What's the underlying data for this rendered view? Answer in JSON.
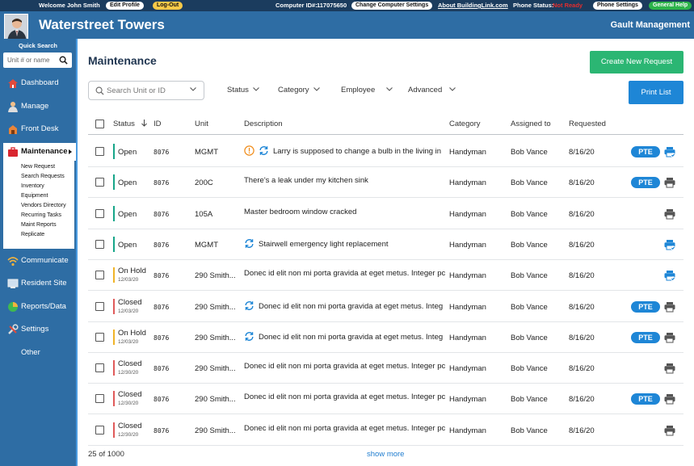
{
  "topbar": {
    "welcome": "Welcome John Smith",
    "edit_profile": "Edit Profile",
    "logout": "Log-Out",
    "computer_id_label": "Computer ID#:",
    "computer_id": "117075650",
    "change_computer_settings": "Change Computer Settings",
    "about": "About BuildingLink.com",
    "phone_status_label": "Phone Status:",
    "phone_status": "Not Ready",
    "phone_settings": "Phone Settings",
    "general_help": "General Help"
  },
  "header": {
    "building_name": "Waterstreet Towers",
    "company_name": "Gault Management"
  },
  "sidebar": {
    "quick_search_label": "Quick Search",
    "quick_search_placeholder": "Unit # or name",
    "items": [
      {
        "label": "Dashboard",
        "icon": "dashboard-icon"
      },
      {
        "label": "Manage",
        "icon": "manage-icon"
      },
      {
        "label": "Front Desk",
        "icon": "front-desk-icon"
      },
      {
        "label": "Maintenance",
        "icon": "maintenance-icon"
      },
      {
        "label": "Communicate",
        "icon": "communicate-icon"
      },
      {
        "label": "Resident Site",
        "icon": "resident-site-icon"
      },
      {
        "label": "Reports/Data",
        "icon": "reports-icon"
      },
      {
        "label": "Settings",
        "icon": "settings-icon"
      },
      {
        "label": "Other",
        "icon": ""
      }
    ],
    "submenu": [
      "New Request",
      "Search Requests",
      "Inventory",
      "Equipment",
      "Vendors Directory",
      "Recurring Tasks",
      "Maint Reports",
      "Replicate"
    ]
  },
  "main": {
    "title": "Maintenance",
    "create_button": "Create New Request",
    "print_button": "Print List",
    "search_placeholder": "Search Unit or ID",
    "filters": [
      "Status",
      "Category",
      "Employee",
      "Advanced"
    ],
    "columns": [
      "Status",
      "ID",
      "Unit",
      "Description",
      "Category",
      "Assigned to",
      "Requested"
    ],
    "rows": [
      {
        "status": "Open",
        "date": "",
        "id": "8076",
        "unit": "MGMT",
        "desc": "Larry is supposed to change a bulb in the living in",
        "category": "Handyman",
        "assigned": "Bob Vance",
        "requested": "8/16/20",
        "pte": "PTE",
        "icons": [
          "alert",
          "recurring"
        ],
        "print": "print-check"
      },
      {
        "status": "Open",
        "date": "",
        "id": "8076",
        "unit": "200C",
        "desc": "There's a leak under my kitchen sink",
        "category": "Handyman",
        "assigned": "Bob Vance",
        "requested": "8/16/20",
        "pte": "PTE",
        "icons": [],
        "print": "print"
      },
      {
        "status": "Open",
        "date": "",
        "id": "8076",
        "unit": "105A",
        "desc": "Master bedroom window cracked",
        "category": "Handyman",
        "assigned": "Bob Vance",
        "requested": "8/16/20",
        "pte": "",
        "icons": [],
        "print": "print"
      },
      {
        "status": "Open",
        "date": "",
        "id": "8076",
        "unit": "MGMT",
        "desc": "Stairwell emergency light replacement",
        "category": "Handyman",
        "assigned": "Bob Vance",
        "requested": "8/16/20",
        "pte": "",
        "icons": [
          "recurring"
        ],
        "print": "print-check"
      },
      {
        "status": "On Hold",
        "date": "12/03/20",
        "id": "8076",
        "unit": "290 Smith...",
        "desc": "Donec id elit non mi porta gravida at eget metus. Integer pc",
        "category": "Handyman",
        "assigned": "Bob Vance",
        "requested": "8/16/20",
        "pte": "",
        "icons": [],
        "print": "print-check"
      },
      {
        "status": "Closed",
        "date": "12/03/20",
        "id": "8076",
        "unit": "290 Smith...",
        "desc": "Donec id elit non mi porta gravida at eget metus. Integ",
        "category": "Handyman",
        "assigned": "Bob Vance",
        "requested": "8/16/20",
        "pte": "PTE",
        "icons": [
          "recurring"
        ],
        "print": "print"
      },
      {
        "status": "On Hold",
        "date": "12/03/20",
        "id": "8076",
        "unit": "290 Smith...",
        "desc": "Donec id elit non mi porta gravida at eget metus. Integ",
        "category": "Handyman",
        "assigned": "Bob Vance",
        "requested": "8/16/20",
        "pte": "PTE",
        "icons": [
          "recurring"
        ],
        "print": "print"
      },
      {
        "status": "Closed",
        "date": "12/30/20",
        "id": "8076",
        "unit": "290 Smith...",
        "desc": "Donec id elit non mi porta gravida at eget metus. Integer pc",
        "category": "Handyman",
        "assigned": "Bob Vance",
        "requested": "8/16/20",
        "pte": "",
        "icons": [],
        "print": "print"
      },
      {
        "status": "Closed",
        "date": "12/30/20",
        "id": "8076",
        "unit": "290 Smith...",
        "desc": "Donec id elit non mi porta gravida at eget metus. Integer pc",
        "category": "Handyman",
        "assigned": "Bob Vance",
        "requested": "8/16/20",
        "pte": "PTE",
        "icons": [],
        "print": "print"
      },
      {
        "status": "Closed",
        "date": "12/30/20",
        "id": "8076",
        "unit": "290 Smith...",
        "desc": "Donec id elit non mi porta gravida at eget metus. Integer pc",
        "category": "Handyman",
        "assigned": "Bob Vance",
        "requested": "8/16/20",
        "pte": "",
        "icons": [],
        "print": "print"
      }
    ],
    "footer_count": "25 of 1000",
    "show_more": "show more"
  },
  "colors": {
    "open": "#17a589",
    "on_hold": "#f0b429",
    "closed": "#e05a5a",
    "accent": "#1e86d6",
    "create": "#2bb673"
  }
}
